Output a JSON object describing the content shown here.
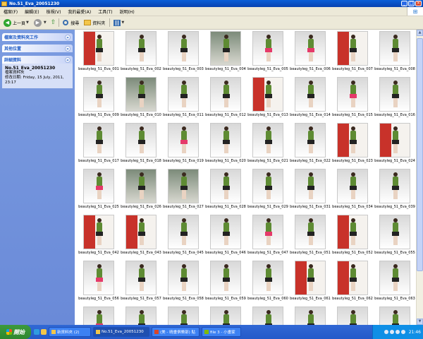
{
  "window": {
    "title": "No.51_Eva_20051230"
  },
  "menubar": {
    "items": [
      "檔案(F)",
      "編輯(E)",
      "檢視(V)",
      "我的最愛(A)",
      "工具(T)",
      "說明(H)"
    ]
  },
  "toolbar": {
    "back_label": "上一頁",
    "search_label": "搜尋",
    "folders_label": "資料夾"
  },
  "sidebar": {
    "panels": [
      {
        "title": "檔案及資料夾工作"
      },
      {
        "title": "其他位置"
      },
      {
        "title": "詳細資料",
        "detail_name": "No.51_Eva_20051230",
        "detail_type": "檔案資料夾",
        "detail_date": "修改日期: Friday, 15 July, 2011, 23:17"
      }
    ]
  },
  "files": [
    {
      "name": "beautyleg_51_Eva_001",
      "style": "red"
    },
    {
      "name": "beautyleg_51_Eva_002",
      "style": "grey"
    },
    {
      "name": "beautyleg_51_Eva_003",
      "style": "grey"
    },
    {
      "name": "beautyleg_51_Eva_004",
      "style": "dark"
    },
    {
      "name": "beautyleg_51_Eva_005",
      "style": "pink"
    },
    {
      "name": "beautyleg_51_Eva_006",
      "style": "pink"
    },
    {
      "name": "beautyleg_51_Eva_007",
      "style": "red"
    },
    {
      "name": "beautyleg_51_Eva_008",
      "style": "grey"
    },
    {
      "name": "beautyleg_51_Eva_009",
      "style": "grey"
    },
    {
      "name": "beautyleg_51_Eva_010",
      "style": "dark"
    },
    {
      "name": "beautyleg_51_Eva_011",
      "style": "grey"
    },
    {
      "name": "beautyleg_51_Eva_012",
      "style": "grey"
    },
    {
      "name": "beautyleg_51_Eva_013",
      "style": "red"
    },
    {
      "name": "beautyleg_51_Eva_014",
      "style": "grey"
    },
    {
      "name": "beautyleg_51_Eva_015",
      "style": "pink"
    },
    {
      "name": "beautyleg_51_Eva_016",
      "style": "grey"
    },
    {
      "name": "beautyleg_51_Eva_017",
      "style": "grey"
    },
    {
      "name": "beautyleg_51_Eva_018",
      "style": "grey"
    },
    {
      "name": "beautyleg_51_Eva_019",
      "style": "pink"
    },
    {
      "name": "beautyleg_51_Eva_020",
      "style": "grey"
    },
    {
      "name": "beautyleg_51_Eva_021",
      "style": "grey"
    },
    {
      "name": "beautyleg_51_Eva_022",
      "style": "grey"
    },
    {
      "name": "beautyleg_51_Eva_023",
      "style": "red"
    },
    {
      "name": "beautyleg_51_Eva_024",
      "style": "red"
    },
    {
      "name": "beautyleg_51_Eva_025",
      "style": "pink"
    },
    {
      "name": "beautyleg_51_Eva_026",
      "style": "dark"
    },
    {
      "name": "beautyleg_51_Eva_027",
      "style": "dark"
    },
    {
      "name": "beautyleg_51_Eva_028",
      "style": "grey"
    },
    {
      "name": "beautyleg_51_Eva_029",
      "style": "grey"
    },
    {
      "name": "beautyleg_51_Eva_031",
      "style": "grey"
    },
    {
      "name": "beautyleg_51_Eva_034",
      "style": "grey"
    },
    {
      "name": "beautyleg_51_Eva_039",
      "style": "grey"
    },
    {
      "name": "beautyleg_51_Eva_042",
      "style": "red"
    },
    {
      "name": "beautyleg_51_Eva_043",
      "style": "red"
    },
    {
      "name": "beautyleg_51_Eva_045",
      "style": "grey"
    },
    {
      "name": "beautyleg_51_Eva_046",
      "style": "grey"
    },
    {
      "name": "beautyleg_51_Eva_047",
      "style": "pink"
    },
    {
      "name": "beautyleg_51_Eva_051",
      "style": "grey"
    },
    {
      "name": "beautyleg_51_Eva_052",
      "style": "red"
    },
    {
      "name": "beautyleg_51_Eva_055",
      "style": "grey"
    },
    {
      "name": "beautyleg_51_Eva_056",
      "style": "pink"
    },
    {
      "name": "beautyleg_51_Eva_057",
      "style": "grey"
    },
    {
      "name": "beautyleg_51_Eva_058",
      "style": "grey"
    },
    {
      "name": "beautyleg_51_Eva_059",
      "style": "grey"
    },
    {
      "name": "beautyleg_51_Eva_060",
      "style": "grey"
    },
    {
      "name": "beautyleg_51_Eva_061",
      "style": "red"
    },
    {
      "name": "beautyleg_51_Eva_062",
      "style": "red"
    },
    {
      "name": "beautyleg_51_Eva_063",
      "style": "grey"
    },
    {
      "name": "",
      "style": "pink"
    },
    {
      "name": "",
      "style": "grey"
    },
    {
      "name": "",
      "style": "grey"
    },
    {
      "name": "",
      "style": "grey"
    },
    {
      "name": "",
      "style": "grey"
    },
    {
      "name": "",
      "style": "grey"
    },
    {
      "name": "",
      "style": "grey"
    },
    {
      "name": "",
      "style": "grey"
    }
  ],
  "taskbar": {
    "start_label": "開始",
    "tasks": [
      {
        "label": "新資料夾 (2)",
        "active": false
      },
      {
        "label": "No.51_Eva_20051230",
        "active": true
      },
      {
        "label": "(美 - 晴畫俱樂部) 貼",
        "active": false
      },
      {
        "label": "file 3 - 小畫家",
        "active": false
      }
    ],
    "clock": "21:46"
  },
  "colors": {
    "titlebar": "#0a5fd8",
    "sidebar": "#7b9ce0",
    "taskbar": "#245ac9",
    "start": "#2f872f"
  }
}
